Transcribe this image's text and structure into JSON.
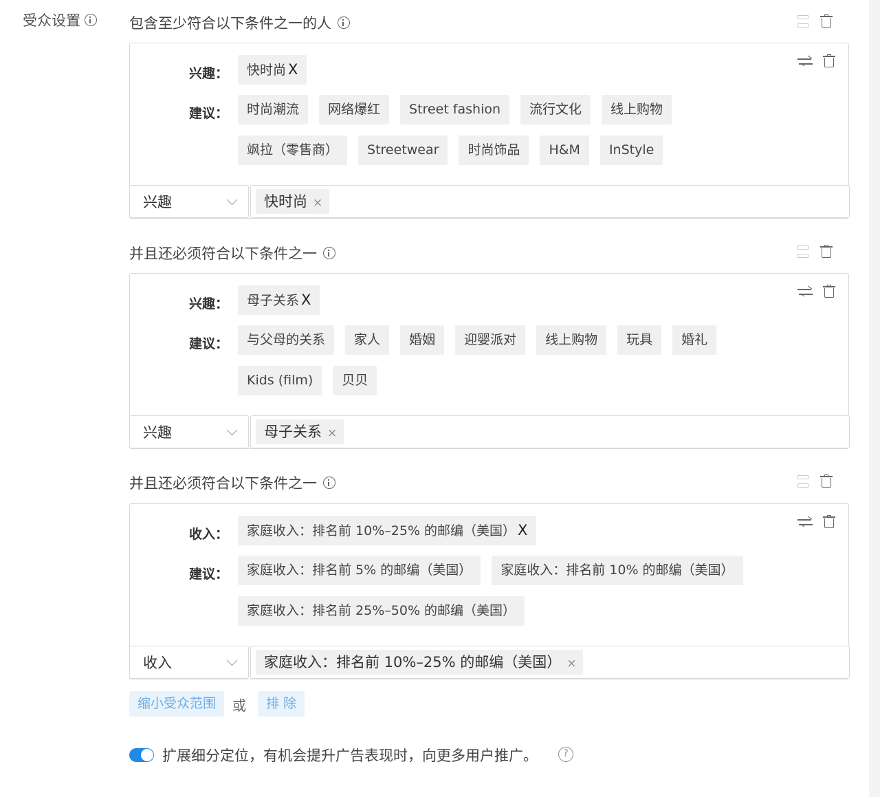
{
  "page": {
    "label": "受众设置"
  },
  "sections": [
    {
      "title": "包含至少符合以下条件之一的人",
      "selected_label": "兴趣：",
      "selected": [
        {
          "text": "快时尚",
          "remove": "X"
        }
      ],
      "suggest_label": "建议：",
      "suggestions": [
        "时尚潮流",
        "网络爆红",
        "Street fashion",
        "流行文化",
        "线上购物",
        "飒拉（零售商）",
        "Streetwear",
        "时尚饰品",
        "H&M",
        "InStyle"
      ],
      "dropdown": "兴趣",
      "tags": [
        {
          "text": "快时尚",
          "remove": "×"
        }
      ]
    },
    {
      "title": "并且还必须符合以下条件之一",
      "selected_label": "兴趣：",
      "selected": [
        {
          "text": "母子关系",
          "remove": "X"
        }
      ],
      "suggest_label": "建议：",
      "suggestions": [
        "与父母的关系",
        "家人",
        "婚姻",
        "迎婴派对",
        "线上购物",
        "玩具",
        "婚礼",
        "Kids (film)",
        "贝贝"
      ],
      "dropdown": "兴趣",
      "tags": [
        {
          "text": "母子关系",
          "remove": "×"
        }
      ]
    },
    {
      "title": "并且还必须符合以下条件之一",
      "selected_label": "收入：",
      "selected": [
        {
          "text": "家庭收入：排名前 10%–25% 的邮编（美国）",
          "remove": "X"
        }
      ],
      "suggest_label": "建议：",
      "suggestions": [
        "家庭收入：排名前 5% 的邮编（美国）",
        "家庭收入：排名前 10% 的邮编（美国）",
        "家庭收入：排名前 25%–50% 的邮编（美国）"
      ],
      "dropdown": "收入",
      "tags": [
        {
          "text": "家庭收入：排名前 10%–25% 的邮编（美国）",
          "remove": "×"
        }
      ]
    }
  ],
  "actions": {
    "narrow": "缩小受众范围",
    "or": "或",
    "exclude": "排 除"
  },
  "expand": {
    "text": "扩展细分定位，有机会提升广告表现时，向更多用户推广。",
    "enabled": true,
    "help": "?"
  },
  "colors": {
    "accent": "#1f8ae8",
    "soft_button_bg": "#e8f3fc",
    "soft_button_text": "#6aaee6",
    "chip_bg": "#f0f0f0"
  }
}
